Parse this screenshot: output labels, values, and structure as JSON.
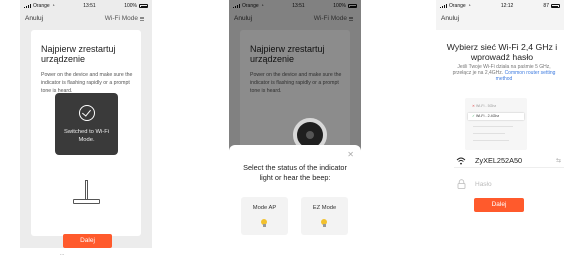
{
  "screens": [
    {
      "status": {
        "carrier": "Orange",
        "time": "13:51",
        "battery": "100%"
      },
      "cancel": "Anuluj",
      "mode": "Wi-Fi Mode",
      "title": "Najpierw zrestartuj urządzenie",
      "instructions": "Power on the device and make sure the indicator is flashing rapidly or a prompt tone is heard.",
      "toast": "Switched to Wi-Fi Mode.",
      "next": "Dalej"
    },
    {
      "status": {
        "carrier": "Orange",
        "time": "13:51",
        "battery": "100%"
      },
      "cancel": "Anuluj",
      "mode": "Wi-Fi Mode",
      "title": "Najpierw zrestartuj urządzenie",
      "instructions": "Power on the device and make sure the indicator is flashing rapidly or a prompt tone is heard.",
      "sheet": {
        "question": "Select the status of the indicator light or hear the beep:",
        "options": [
          "Mode AP",
          "EZ Mode"
        ]
      }
    },
    {
      "status": {
        "carrier": "Orange",
        "time": "12:12",
        "battery": "87"
      },
      "cancel": "Anuluj",
      "title": "Wybierz sieć Wi-Fi 2,4 GHz i wprowadź hasło",
      "subtitle": "Jeśli Twoje Wi-Fi działa na paśmie 5 GHz, przełącz je na 2,4GHz.",
      "subtitle_link": "Common router setting method",
      "router": {
        "row1": "Wi-Fi - 5Ghz",
        "row2": "Wi-Fi - 2.4Ghz"
      },
      "ssid": "ZyXEL252A50",
      "password_placeholder": "Hasło",
      "next": "Dalej"
    }
  ],
  "caption": "...",
  "colors": {
    "accent": "#ff5a2c",
    "link": "#3d7be0",
    "toast": "#3a3a3a"
  },
  "icons": [
    "signal-icon",
    "wifi-icon",
    "battery-icon",
    "settings-icon",
    "check-circle-icon",
    "close-icon",
    "bulb-icon",
    "lock-icon",
    "switch-icon"
  ]
}
